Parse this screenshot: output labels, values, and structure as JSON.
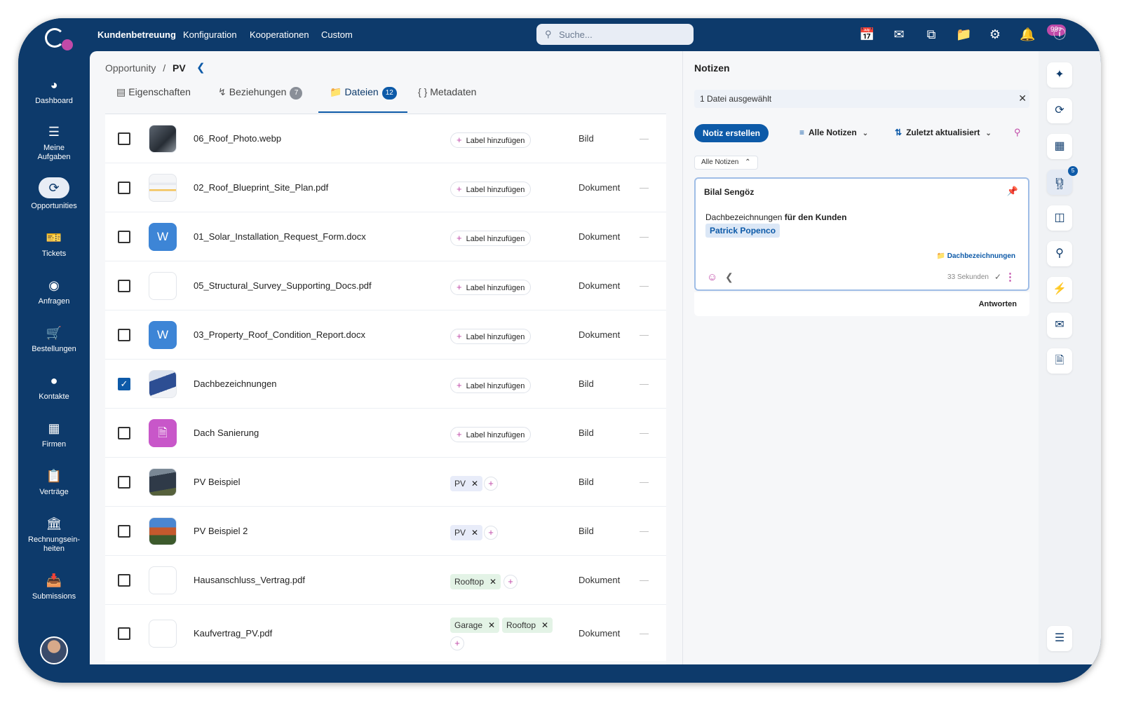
{
  "topbar": {
    "nav": [
      "Kundenbetreuung",
      "Konfiguration",
      "Kooperationen",
      "Custom"
    ],
    "search_placeholder": "Suche...",
    "icons": [
      "calendar-icon",
      "mail-icon",
      "copy-icon",
      "folder-icon",
      "settings-icon",
      "bell-icon",
      "info-icon"
    ],
    "notification_badge": "99+"
  },
  "sidebar": {
    "items": [
      {
        "label": "Dashboard",
        "icon": "dashboard-icon"
      },
      {
        "label": "Meine Aufgaben",
        "icon": "tasks-icon"
      },
      {
        "label": "Opportunities",
        "icon": "sync-icon"
      },
      {
        "label": "Tickets",
        "icon": "ticket-icon"
      },
      {
        "label": "Anfragen",
        "icon": "globe-icon"
      },
      {
        "label": "Bestellungen",
        "icon": "cart-icon"
      },
      {
        "label": "Kontakte",
        "icon": "person-icon"
      },
      {
        "label": "Firmen",
        "icon": "building-icon"
      },
      {
        "label": "Verträge",
        "icon": "clipboard-icon"
      },
      {
        "label": "Rechnungsein-heiten",
        "icon": "bank-icon"
      },
      {
        "label": "Submissions",
        "icon": "inbox-icon"
      }
    ],
    "active": "Opportunities"
  },
  "breadcrumb": {
    "parent": "Opportunity",
    "separator": "/",
    "current": "PV"
  },
  "tabs": [
    {
      "label": "Eigenschaften",
      "count": ""
    },
    {
      "label": "Beziehungen",
      "count": "7"
    },
    {
      "label": "Dateien",
      "count": "12"
    },
    {
      "label": "Metadaten",
      "count": ""
    }
  ],
  "active_tab": "Dateien",
  "add_label_text": "Label hinzufügen",
  "files": [
    {
      "name": "06_Roof_Photo.webp",
      "type": "Bild",
      "checked": false,
      "labels": [],
      "thumb": "photo-dark"
    },
    {
      "name": "02_Roof_Blueprint_Site_Plan.pdf",
      "type": "Dokument",
      "checked": false,
      "labels": [],
      "thumb": "blueprint"
    },
    {
      "name": "01_Solar_Installation_Request_Form.docx",
      "type": "Dokument",
      "checked": false,
      "labels": [],
      "thumb": "word",
      "thumb_letter": "W"
    },
    {
      "name": "05_Structural_Survey_Supporting_Docs.pdf",
      "type": "Dokument",
      "checked": false,
      "labels": [],
      "thumb": "plain"
    },
    {
      "name": "03_Property_Roof_Condition_Report.docx",
      "type": "Dokument",
      "checked": false,
      "labels": [],
      "thumb": "word",
      "thumb_letter": "W"
    },
    {
      "name": "Dachbezeichnungen",
      "type": "Bild",
      "checked": true,
      "labels": [],
      "thumb": "photo-house"
    },
    {
      "name": "Dach Sanierung",
      "type": "Bild",
      "checked": false,
      "labels": [],
      "thumb": "pink"
    },
    {
      "name": "PV Beispiel",
      "type": "Bild",
      "checked": false,
      "labels": [
        "PV"
      ],
      "thumb": "photo-pv"
    },
    {
      "name": "PV Beispiel 2",
      "type": "Bild",
      "checked": false,
      "labels": [
        "PV"
      ],
      "thumb": "photo-pv2"
    },
    {
      "name": "Hausanschluss_Vertrag.pdf",
      "type": "Dokument",
      "checked": false,
      "labels": [
        "Rooftop"
      ],
      "thumb": "plain"
    },
    {
      "name": "Kaufvertrag_PV.pdf",
      "type": "Dokument",
      "checked": false,
      "labels": [
        "Garage",
        "Rooftop"
      ],
      "thumb": "plain"
    }
  ],
  "notes": {
    "title": "Notizen",
    "selection": "1 Datei ausgewählt",
    "create_button": "Notiz erstellen",
    "filter": "Alle Notizen",
    "sort": "Zuletzt aktualisiert",
    "chip": "Alle Notizen",
    "card": {
      "author": "Bilal Sengöz",
      "text_pre": "Dachbezeichnungen",
      "text_bold": "für den Kunden",
      "mention": "Patrick Popenco",
      "folder": "Dachbezeichnungen",
      "time": "33 Sekunden"
    },
    "reply": "Antworten"
  },
  "rail": {
    "icons": [
      "sparkle-icon",
      "history-icon",
      "apps-icon",
      "notes-icon",
      "hierarchy-icon",
      "network-icon",
      "bolt-icon",
      "mail-icon",
      "document-icon",
      "list-icon"
    ],
    "notes_badge": "5",
    "notes_count": "16"
  },
  "colors": {
    "navy": "#0d3a6b",
    "accent": "#0d5aa8",
    "magenta": "#c04aa8"
  }
}
